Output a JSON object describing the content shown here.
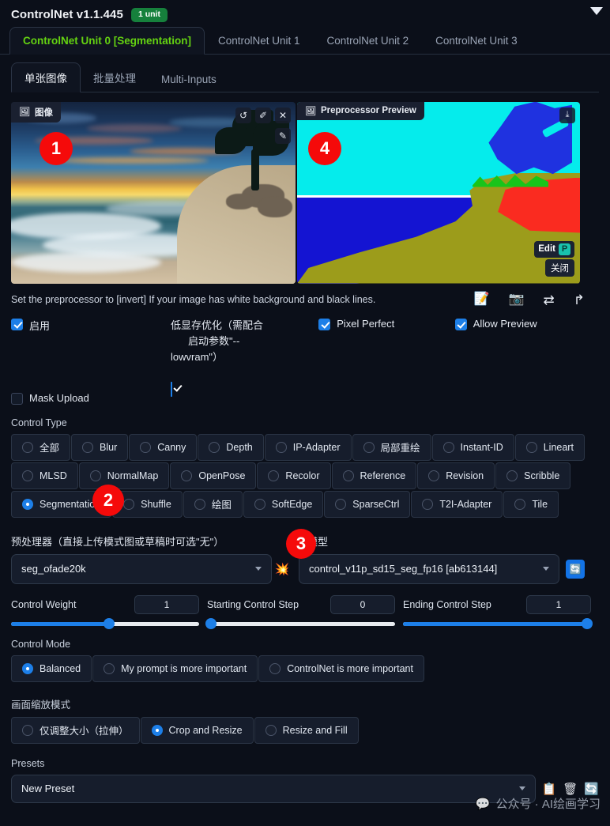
{
  "header": {
    "title": "ControlNet v1.1.445",
    "unit_badge": "1 unit",
    "collapse_icon": "chevron-down-icon"
  },
  "unit_tabs": [
    {
      "label": "ControlNet Unit 0 [Segmentation]",
      "active": true
    },
    {
      "label": "ControlNet Unit 1",
      "active": false
    },
    {
      "label": "ControlNet Unit 2",
      "active": false
    },
    {
      "label": "ControlNet Unit 3",
      "active": false
    }
  ],
  "sub_tabs": [
    {
      "label": "单张图像",
      "active": true
    },
    {
      "label": "批量处理",
      "active": false
    },
    {
      "label": "Multi-Inputs",
      "active": false
    }
  ],
  "image_panel": {
    "input_label": "图像",
    "input_badge": "1",
    "preview_label": "Preprocessor Preview",
    "preview_badge": "4",
    "tools": {
      "undo": "↺",
      "eraser": "✐",
      "close": "✕",
      "brush": "✎",
      "download": "⤓"
    },
    "edit_button": "Edit",
    "photopea_icon": "P",
    "close_button": "关闭"
  },
  "hint": "Set the preprocessor to [invert] If your image has white background and black lines.",
  "icon_toolbar": [
    {
      "name": "note-icon",
      "glyph": "📝"
    },
    {
      "name": "camera-icon",
      "glyph": "📷"
    },
    {
      "name": "swap-icon",
      "glyph": "⇄"
    },
    {
      "name": "send-icon",
      "glyph": "↱"
    }
  ],
  "checkboxes": [
    {
      "label": "启用",
      "checked": true
    },
    {
      "label": "低显存优化（需配合启动参数\"--lowvram\"）",
      "checked": true
    },
    {
      "label": "Pixel Perfect",
      "checked": true
    },
    {
      "label": "Allow Preview",
      "checked": true
    },
    {
      "label": "Mask Upload",
      "checked": false
    }
  ],
  "lowvram": {
    "line1": "低显存优化（需配合",
    "line2": "启动参数\"--",
    "line3": "lowvram\"）"
  },
  "control_type": {
    "label": "Control Type",
    "options": [
      {
        "label": "全部",
        "selected": false
      },
      {
        "label": "Blur",
        "selected": false
      },
      {
        "label": "Canny",
        "selected": false
      },
      {
        "label": "Depth",
        "selected": false
      },
      {
        "label": "IP-Adapter",
        "selected": false
      },
      {
        "label": "局部重绘",
        "selected": false
      },
      {
        "label": "Instant-ID",
        "selected": false
      },
      {
        "label": "Lineart",
        "selected": false
      },
      {
        "label": "MLSD",
        "selected": false
      },
      {
        "label": "NormalMap",
        "selected": false
      },
      {
        "label": "OpenPose",
        "selected": false
      },
      {
        "label": "Recolor",
        "selected": false
      },
      {
        "label": "Reference",
        "selected": false
      },
      {
        "label": "Revision",
        "selected": false
      },
      {
        "label": "Scribble",
        "selected": false
      },
      {
        "label": "Segmentation",
        "selected": true
      },
      {
        "label": "Shuffle",
        "selected": false
      },
      {
        "label": "绘图",
        "selected": false
      },
      {
        "label": "SoftEdge",
        "selected": false
      },
      {
        "label": "SparseCtrl",
        "selected": false
      },
      {
        "label": "T2I-Adapter",
        "selected": false
      },
      {
        "label": "Tile",
        "selected": false
      }
    ],
    "badge": "2"
  },
  "preprocessor": {
    "label": "预处理器（直接上传模式图或草稿时可选\"无\"）",
    "value": "seg_ofade20k",
    "run_icon": "burst-icon",
    "badge": "3"
  },
  "model": {
    "label": "模型",
    "value": "control_v11p_sd15_seg_fp16 [ab613144]",
    "refresh_icon": "refresh-icon"
  },
  "sliders": [
    {
      "name": "Control Weight",
      "value": "1",
      "percent": 52
    },
    {
      "name": "Starting Control Step",
      "value": "0",
      "percent": 0
    },
    {
      "name": "Ending Control Step",
      "value": "1",
      "percent": 100
    }
  ],
  "control_mode": {
    "label": "Control Mode",
    "options": [
      {
        "label": "Balanced",
        "selected": true
      },
      {
        "label": "My prompt is more important",
        "selected": false
      },
      {
        "label": "ControlNet is more important",
        "selected": false
      }
    ]
  },
  "resize_mode": {
    "label": "画面缩放模式",
    "options": [
      {
        "label": "仅调整大小（拉伸）",
        "selected": false
      },
      {
        "label": "Crop and Resize",
        "selected": true
      },
      {
        "label": "Resize and Fill",
        "selected": false
      }
    ]
  },
  "presets": {
    "label": "Presets",
    "value": "New Preset",
    "icons": [
      {
        "name": "save-icon",
        "glyph": "📋"
      },
      {
        "name": "delete-icon",
        "glyph": "🗑"
      },
      {
        "name": "refresh-icon",
        "glyph": "🔄"
      }
    ]
  },
  "watermark": {
    "icon": "wechat-icon",
    "text": "公众号 · AI绘画学习"
  },
  "colors": {
    "accent_green": "#64d211",
    "accent_blue": "#1d7fe8",
    "badge_red": "#f50a0a",
    "badge_green": "#16803c",
    "background": "#0b0f19"
  }
}
